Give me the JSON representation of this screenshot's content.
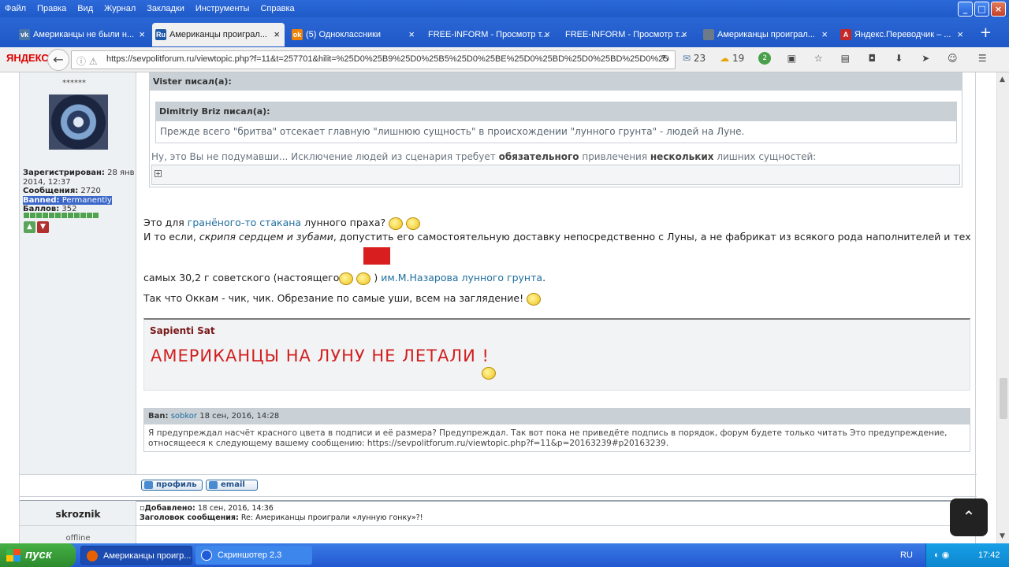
{
  "menubar": {
    "items": [
      "Файл",
      "Правка",
      "Вид",
      "Журнал",
      "Закладки",
      "Инструменты",
      "Справка"
    ]
  },
  "tabs": [
    {
      "title": "Американцы не были н...",
      "icon_text": "vk",
      "icon_color": "#4a76a8"
    },
    {
      "title": "Американцы проиграл...",
      "icon_text": "Ru",
      "icon_color": "#1f5aa8"
    },
    {
      "title": "(5) Одноклассники",
      "icon_text": "ok",
      "icon_color": "#ee8208"
    },
    {
      "title": "FREE-INFORM - Просмотр т...",
      "icon_text": "",
      "icon_color": ""
    },
    {
      "title": "FREE-INFORM - Просмотр т...",
      "icon_text": "",
      "icon_color": ""
    },
    {
      "title": "Американцы проиграл...",
      "icon_text": "",
      "icon_color": "#6d7a8a"
    },
    {
      "title": "Яндекс.Переводчик – ...",
      "icon_text": "A",
      "icon_color": "#c62828"
    }
  ],
  "navbar": {
    "logo": "ЯНДЕКС",
    "url": "https://sevpolitforum.ru/viewtopic.php?f=11&t=257701&hilit=%25D0%25B9%25D0%25B5%25D0%25BE%25D0%25BD%25D0%25BD%25D0%25BB",
    "mail_count": "23",
    "weather_temp": "19",
    "badge_count": "2"
  },
  "poster": {
    "stars": "******",
    "registered_label": "Зарегистрирован:",
    "registered_value": "28 янв 2014, 12:37",
    "messages_label": "Сообщения:",
    "messages_value": "2720",
    "banned_label": "Banned:",
    "banned_value": "Permanently",
    "points_label": "Баллов:",
    "points_value": "352"
  },
  "post": {
    "quote_outer_author": "Vister писал(а):",
    "quote_inner_author": "Dimitriy Briz писал(а):",
    "quote_inner_text": "Прежде всего \"бритва\" отсекает главную \"лишнюю сущность\" в происхождении \"лунного грунта\" - людей на Луне.",
    "quote_outer_text_1": "Ну, это Вы не подумавши... Исключение людей из сценария требует ",
    "quote_outer_bold_1": "обязательного",
    "quote_outer_text_2": " привлечения ",
    "quote_outer_bold_2": "нескольких",
    "quote_outer_text_3": " лишних сущностей:",
    "line1_a": "Это для ",
    "line1_link": "гранёного-то стакана",
    "line1_b": " лунного праха?",
    "line2_a": "И то если, ",
    "line2_italic": "скрипя сердцем и зубами",
    "line2_b": ", допустить его самостоятельную доставку непосредственно с Луны, а не фабрикат из всякого рода наполнителей и тех",
    "line3_a": "самых 30,2 г советского (настоящего",
    "line3_b": ")",
    "line3_link": "им.М.Назарова лунного грунта",
    "line3_c": ".",
    "line4": "Так что Оккам - чик, чик. Обрезание по самые уши, всем на заглядение!"
  },
  "signature": {
    "name": "Sapienti Sat",
    "big_text": "АМЕРИКАНЦЫ НА ЛУНУ НЕ ЛЕТАЛИ !"
  },
  "ban_notice": {
    "label": "Ban:",
    "moderator": "sobkor",
    "date": "18 сен, 2016, 14:28",
    "text": "Я предупреждал насчёт красного цвета в подписи и её размера? Предупреждал. Так вот пока не приведёте подпись в порядок, форум будете только читать Это предупреждение, относящееся к следующему вашему сообщению: https://sevpolitforum.ru/viewtopic.php?f=11&p=20163239#p20163239."
  },
  "actions": {
    "profile_label": "профиль",
    "email_label": "email"
  },
  "next_post": {
    "username": "skroznik",
    "status": "offline",
    "added_label": "Добавлено:",
    "added_value": "18 сен, 2016, 14:36",
    "subject_label": "Заголовок сообщения:",
    "subject_value": "Re: Американцы проиграли «лунную гонку»?!"
  },
  "taskbar": {
    "start_label": "пуск",
    "buttons": [
      {
        "label": "Американцы проигр..."
      },
      {
        "label": "Скриншотер 2.3"
      }
    ],
    "lang": "RU",
    "time": "17:42"
  },
  "colors": {
    "xp_blue": "#2257d0",
    "quote_header": "#c9d0d6",
    "signature_red": "#d21f1f",
    "link": "#1f6e9e"
  }
}
